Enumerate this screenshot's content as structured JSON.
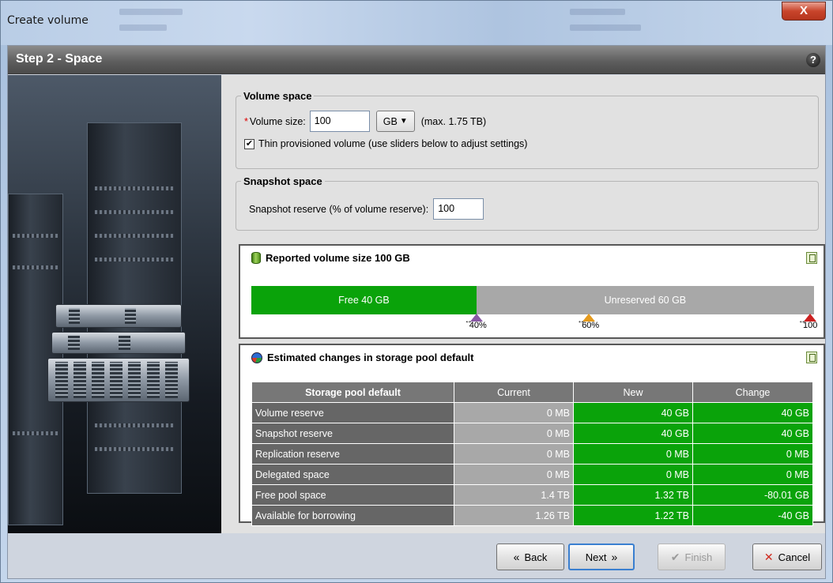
{
  "window": {
    "title": "Create volume",
    "close_glyph": "X"
  },
  "step": {
    "title": "Step 2 - Space",
    "help_glyph": "?"
  },
  "volume_space": {
    "legend": "Volume space",
    "required_mark": "*",
    "size_label": "Volume size:",
    "size_value": "100",
    "unit": "GB",
    "max_text": "(max. 1.75 TB)",
    "thin_checked": true,
    "thin_label": "Thin provisioned volume (use sliders below to adjust settings)"
  },
  "snapshot_space": {
    "legend": "Snapshot space",
    "reserve_label": "Snapshot reserve (% of volume reserve):",
    "reserve_value": "100"
  },
  "reported": {
    "title": "Reported volume size 100 GB",
    "free_label": "Free 40 GB",
    "free_fraction": 0.4,
    "unreserved_label": "Unreserved 60 GB",
    "markers": [
      {
        "label": "40%",
        "value": 0.4,
        "color": "#8a5aa5"
      },
      {
        "label": "60%",
        "value": 0.6,
        "color": "#e59a1c"
      },
      {
        "label": "100",
        "value": 1.0,
        "color": "#cc2020"
      }
    ]
  },
  "estimated": {
    "title": "Estimated changes in storage pool default",
    "columns": [
      "Storage pool default",
      "Current",
      "New",
      "Change"
    ],
    "rows": [
      [
        "Volume reserve",
        "0 MB",
        "40 GB",
        "40 GB"
      ],
      [
        "Snapshot reserve",
        "0 MB",
        "40 GB",
        "40 GB"
      ],
      [
        "Replication reserve",
        "0 MB",
        "0 MB",
        "0 MB"
      ],
      [
        "Delegated space",
        "0 MB",
        "0 MB",
        "0 MB"
      ],
      [
        "Free pool space",
        "1.4 TB",
        "1.32 TB",
        "-80.01 GB"
      ],
      [
        "Available for borrowing",
        "1.26 TB",
        "1.22 TB",
        "-40 GB"
      ]
    ]
  },
  "buttons": {
    "back": "Back",
    "next": "Next",
    "finish": "Finish",
    "cancel": "Cancel"
  },
  "colors": {
    "accent_green": "#0aa30a",
    "header_gray": "#777777",
    "unreserved_gray": "#a8a8a8"
  }
}
